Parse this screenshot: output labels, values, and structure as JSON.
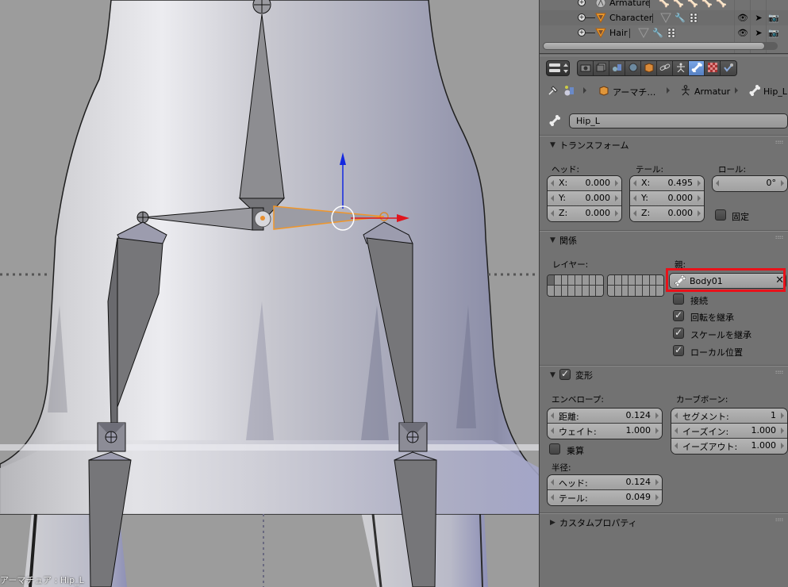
{
  "viewport": {
    "status_text": "アーマチュア : Hip_L",
    "colors": {
      "background": "#9c9c9c",
      "mesh_light": "#dcdce0",
      "mesh_shadow": "#8d8fa6",
      "bone_fill": "#8a8a8e",
      "selected_bone_outline": "#f0962a",
      "gizmo_x": "#e0141c",
      "gizmo_z": "#1428e0"
    },
    "selected_bone": "Hip_L"
  },
  "outliner": {
    "rows": [
      {
        "name": "Armature",
        "type": "armature",
        "mini_icons": [
          "bone-icon",
          "bone-icon",
          "bone-icon",
          "bone-icon",
          "bone-icon"
        ]
      },
      {
        "name": "Character",
        "type": "mesh",
        "mini_icons": [
          "mesh-data-icon",
          "modifier-wrench-icon",
          "vertex-groups-icon"
        ]
      },
      {
        "name": "Hair",
        "type": "mesh",
        "mini_icons": [
          "mesh-data-icon",
          "modifier-wrench-icon",
          "vertex-groups-icon"
        ]
      }
    ],
    "restrict_columns": [
      "visibility-eye-icon",
      "selectability-cursor-icon",
      "render-camera-icon"
    ]
  },
  "properties": {
    "tabs": [
      {
        "name": "render",
        "icon": "camera-icon"
      },
      {
        "name": "render-layers",
        "icon": "render-layers-icon"
      },
      {
        "name": "scene",
        "icon": "scene-icon"
      },
      {
        "name": "world",
        "icon": "world-icon"
      },
      {
        "name": "object",
        "icon": "object-cube-icon"
      },
      {
        "name": "constraints",
        "icon": "constraint-link-icon"
      },
      {
        "name": "data",
        "icon": "armature-data-icon"
      },
      {
        "name": "bone",
        "icon": "bone-icon",
        "active": true
      },
      {
        "name": "texture",
        "icon": "texture-checker-icon"
      },
      {
        "name": "bone-constraint",
        "icon": "bone-constraint-icon"
      }
    ],
    "breadcrumb": {
      "items": [
        "アーマチ…",
        "Armatur",
        "Hip_L"
      ]
    },
    "bone_name": "Hip_L",
    "transform": {
      "title": "トランスフォーム",
      "head_label": "ヘッド:",
      "tail_label": "テール:",
      "roll_label": "ロール:",
      "head": [
        {
          "axis": "X:",
          "value": "0.000"
        },
        {
          "axis": "Y:",
          "value": "0.000"
        },
        {
          "axis": "Z:",
          "value": "0.000"
        }
      ],
      "tail": [
        {
          "axis": "X:",
          "value": "0.495"
        },
        {
          "axis": "Y:",
          "value": "0.000"
        },
        {
          "axis": "Z:",
          "value": "0.000"
        }
      ],
      "roll": "0°",
      "lock_label": "固定",
      "lock_checked": false
    },
    "relations": {
      "title": "関係",
      "layers_label": "レイヤー:",
      "parent_label": "親:",
      "parent_value": "Body01",
      "connected_label": "接続",
      "connected": false,
      "inherit_rotation_label": "回転を継承",
      "inherit_rotation": true,
      "inherit_scale_label": "スケールを継承",
      "inherit_scale": true,
      "local_location_label": "ローカル位置",
      "local_location": true
    },
    "deform": {
      "title": "変形",
      "enabled": true,
      "envelope_label": "エンベロープ:",
      "distance_label": "距離:",
      "distance": "0.124",
      "weight_label": "ウェイト:",
      "weight": "1.000",
      "multiply_label": "乗算",
      "multiply": false,
      "radius_label": "半径:",
      "radius_head_label": "ヘッド:",
      "radius_head": "0.124",
      "radius_tail_label": "テール:",
      "radius_tail": "0.049",
      "curved_bones_label": "カーブボーン:",
      "segments_label": "セグメント:",
      "segments": "1",
      "ease_in_label": "イーズイン:",
      "ease_in": "1.000",
      "ease_out_label": "イーズアウト:",
      "ease_out": "1.000"
    },
    "custom_props": {
      "title": "カスタムプロパティ"
    }
  },
  "annotation": {
    "highlight_color": "#e8121a",
    "target": "parent-field"
  }
}
